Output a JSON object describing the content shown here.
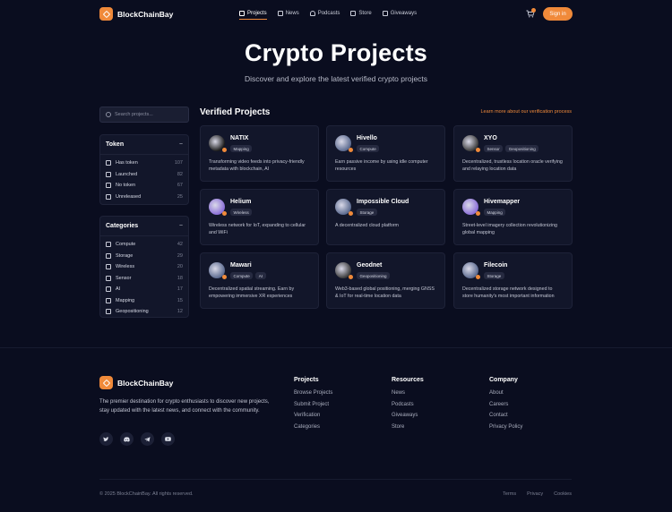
{
  "brand": {
    "name": "BlockChainBay",
    "accent": "#f08a3a"
  },
  "nav": {
    "items": [
      {
        "label": "Projects",
        "icon": "chart-icon",
        "active": true
      },
      {
        "label": "News",
        "icon": "newspaper-icon"
      },
      {
        "label": "Podcasts",
        "icon": "headphones-icon"
      },
      {
        "label": "Store",
        "icon": "cart-icon"
      },
      {
        "label": "Giveaways",
        "icon": "gift-icon"
      }
    ],
    "signin": "Sign in"
  },
  "hero": {
    "title": "Crypto Projects",
    "subtitle": "Discover and explore the latest verified crypto projects"
  },
  "search": {
    "placeholder": "Search projects..."
  },
  "filters": {
    "token": {
      "title": "Token",
      "collapse": "−",
      "options": [
        {
          "label": "Has token",
          "count": "107"
        },
        {
          "label": "Launched",
          "count": "82"
        },
        {
          "label": "No token",
          "count": "67"
        },
        {
          "label": "Unreleased",
          "count": "25"
        }
      ]
    },
    "categories": {
      "title": "Categories",
      "collapse": "−",
      "options": [
        {
          "label": "Compute",
          "count": "42"
        },
        {
          "label": "Storage",
          "count": "29"
        },
        {
          "label": "Wireless",
          "count": "20"
        },
        {
          "label": "Sensor",
          "count": "18"
        },
        {
          "label": "AI",
          "count": "17"
        },
        {
          "label": "Mapping",
          "count": "15"
        },
        {
          "label": "Geopositioning",
          "count": "12"
        }
      ]
    }
  },
  "main": {
    "title": "Verified Projects",
    "learn_more": "Learn more about our verification process",
    "projects": [
      {
        "name": "NATIX",
        "tags": [
          "Mapping"
        ],
        "desc": "Transforming video feeds into privacy-friendly metadata with blockchain, AI",
        "color": "#1b1b1b"
      },
      {
        "name": "Hivello",
        "tags": [
          "Compute"
        ],
        "desc": "Earn passive income by using idle computer resources",
        "color": "#5b6a8f"
      },
      {
        "name": "XYO",
        "tags": [
          "Sensor",
          "Geopositioning"
        ],
        "desc": "Decentralized, trustless location oracle verifying and relaying location data",
        "color": "#3a3a3a"
      },
      {
        "name": "Helium",
        "tags": [
          "Wireless"
        ],
        "desc": "Wireless network for IoT, expanding to cellular and WiFi",
        "color": "#8b6fd8"
      },
      {
        "name": "Impossible Cloud",
        "tags": [
          "Storage"
        ],
        "desc": "A decentralized cloud platform",
        "color": "#5b6a8f"
      },
      {
        "name": "Hivemapper",
        "tags": [
          "Mapping"
        ],
        "desc": "Street-level imagery collection revolutionizing global mapping",
        "color": "#8b6fd8"
      },
      {
        "name": "Mawari",
        "tags": [
          "Compute",
          "AI"
        ],
        "desc": "Decentralized spatial streaming. Earn by empowering immersive XR experiences",
        "color": "#5b6a8f"
      },
      {
        "name": "Geodnet",
        "tags": [
          "Geopositioning"
        ],
        "desc": "Web3-based global positioning, merging GNSS & IoT for real-time location data",
        "color": "#3a3a3a"
      },
      {
        "name": "Filecoin",
        "tags": [
          "Storage"
        ],
        "desc": "Decentralized storage network designed to store humanity's most important information",
        "color": "#5b6a8f"
      }
    ]
  },
  "footer": {
    "brand": "BlockChainBay",
    "description": "The premier destination for crypto enthusiasts to discover new projects, stay updated with the latest news, and connect with the community.",
    "socials": [
      "twitter-icon",
      "discord-icon",
      "telegram-icon",
      "youtube-icon"
    ],
    "columns": [
      {
        "title": "Projects",
        "links": [
          "Browse Projects",
          "Submit Project",
          "Verification",
          "Categories"
        ]
      },
      {
        "title": "Resources",
        "links": [
          "News",
          "Podcasts",
          "Giveaways",
          "Store"
        ]
      },
      {
        "title": "Company",
        "links": [
          "About",
          "Careers",
          "Contact",
          "Privacy Policy"
        ]
      }
    ],
    "copyright": "© 2025 BlockChainBay. All rights reserved.",
    "bottom_links": [
      "Terms",
      "Privacy",
      "Cookies"
    ]
  }
}
